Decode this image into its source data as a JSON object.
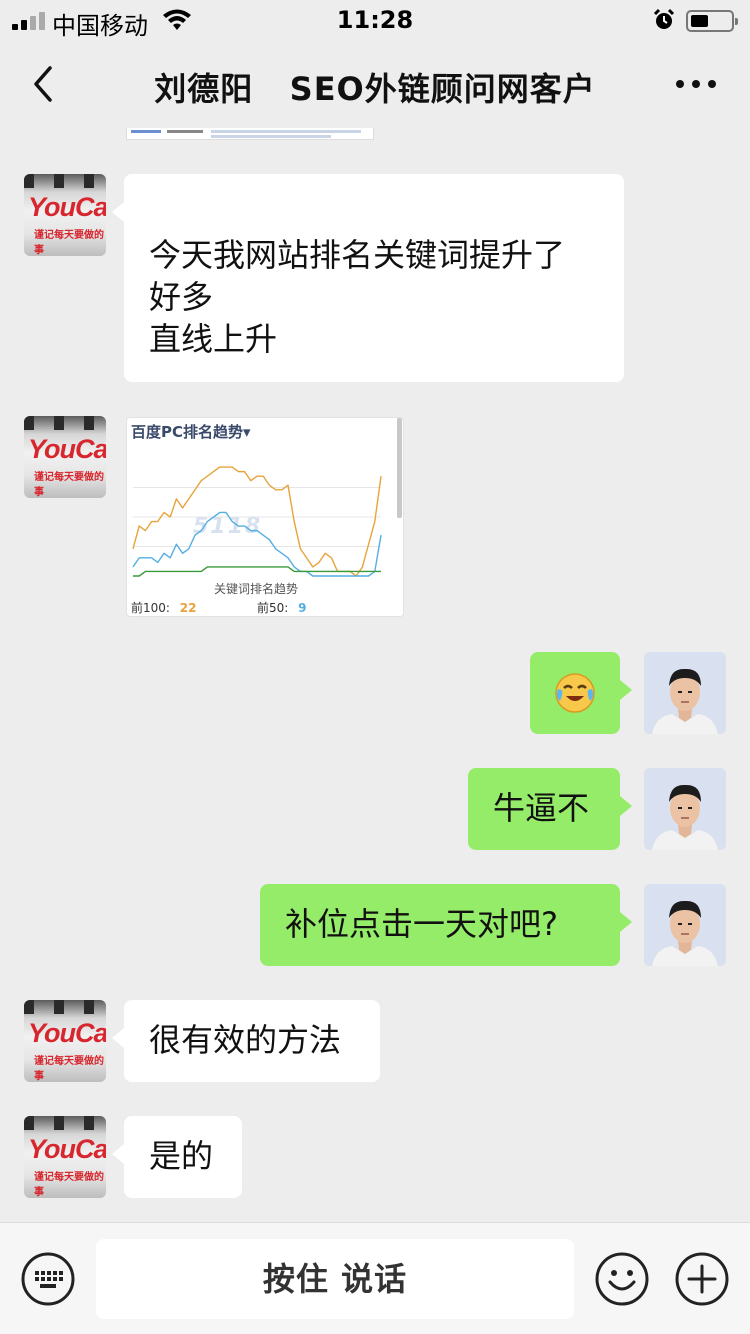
{
  "status_bar": {
    "carrier": "中国移动",
    "time": "11:28"
  },
  "nav": {
    "title": "刘德阳   SEO外链顾问网客户"
  },
  "messages": [
    {
      "from": "other",
      "avatar": "youcan-logo-avatar",
      "lines": [
        "今天我网站排名关键词提升了",
        "好多",
        "直线上升"
      ]
    },
    {
      "from": "other",
      "avatar": "youcan-logo-avatar",
      "type": "image",
      "image": "ranking-trend-chart"
    },
    {
      "from": "self",
      "avatar": "user-photo-avatar",
      "type": "emoji",
      "emoji": "😭"
    },
    {
      "from": "self",
      "avatar": "user-photo-avatar",
      "lines": [
        "牛逼不"
      ]
    },
    {
      "from": "self",
      "avatar": "user-photo-avatar",
      "lines": [
        "补位点击一天对吧?"
      ]
    },
    {
      "from": "other",
      "avatar": "youcan-logo-avatar",
      "lines": [
        "很有效的方法"
      ]
    },
    {
      "from": "other",
      "avatar": "youcan-logo-avatar",
      "lines": [
        "是的"
      ]
    }
  ],
  "avatars": {
    "brand_text": "YouCan!",
    "slogan_text": "谨记每天要做的事"
  },
  "chart_image": {
    "title": "百度PC排名趋势▾",
    "watermark": "5118",
    "xlabel": "关键词排名趋势",
    "top100_label": "前100:",
    "top100_value": "22",
    "top50_label": "前50:",
    "top50_value": "9",
    "colors": {
      "top100": "#e8a33c",
      "top50": "#53aee3",
      "top10": "#3a9a3a"
    }
  },
  "chart_data": {
    "type": "line",
    "title": "百度PC排名趋势",
    "xlabel": "关键词排名趋势",
    "ylabel": "",
    "x": [
      0,
      1,
      2,
      3,
      4,
      5,
      6,
      7,
      8,
      9,
      10,
      11,
      12,
      13,
      14,
      15,
      16,
      17,
      18,
      19,
      20,
      21,
      22,
      23,
      24,
      25,
      26,
      27,
      28,
      29,
      30,
      31,
      32,
      33,
      34,
      35,
      36,
      37,
      38,
      39,
      40
    ],
    "ylim": [
      0,
      26
    ],
    "series": [
      {
        "name": "前100",
        "values": [
          6,
          11,
          10,
          12,
          12,
          14,
          13,
          17,
          15,
          17,
          19,
          21,
          22,
          23,
          24,
          24,
          24,
          23,
          23,
          21,
          22,
          22,
          20,
          19,
          19,
          20,
          12,
          6,
          4,
          2,
          3,
          5,
          4,
          1,
          1,
          1,
          0,
          2,
          7,
          12,
          22
        ]
      },
      {
        "name": "前50",
        "values": [
          2,
          4,
          4,
          4,
          3,
          5,
          4,
          7,
          5,
          6,
          9,
          10,
          12,
          13,
          14,
          14,
          12,
          11,
          11,
          10,
          10,
          9,
          8,
          6,
          5,
          4,
          2,
          1,
          1,
          0,
          0,
          0,
          0,
          0,
          0,
          0,
          0,
          0,
          0,
          1,
          9
        ]
      },
      {
        "name": "",
        "values": [
          0,
          0,
          1,
          1,
          1,
          1,
          1,
          1,
          1,
          1,
          1,
          1,
          2,
          2,
          2,
          2,
          2,
          2,
          2,
          2,
          2,
          2,
          2,
          2,
          2,
          2,
          1,
          1,
          1,
          1,
          1,
          1,
          1,
          1,
          1,
          1,
          1,
          1,
          1,
          1,
          1
        ]
      }
    ]
  },
  "input_bar": {
    "voice_label": "按住 说话"
  }
}
